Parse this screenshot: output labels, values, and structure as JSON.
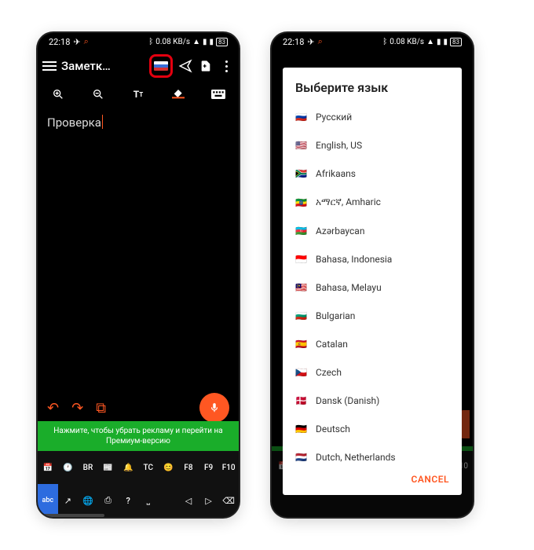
{
  "status": {
    "time": "22:18",
    "right_text": "0.08 KB/s",
    "icons": "✈ ⌕ ⋯"
  },
  "left": {
    "title": "Заметк…",
    "editor_text": "Проверка",
    "promo": "Нажмите, чтобы убрать рекламу и перейти на Премиум-версию",
    "kb_row1": [
      "📅",
      "🕐",
      "BR",
      "📰",
      "🔔",
      "TC",
      "😊",
      "F8",
      "F9",
      "F10"
    ],
    "kb_row2": [
      "abc",
      "↗",
      "🌐",
      "⎙",
      "?",
      "⎵",
      "",
      "◁",
      "▷",
      "⌫"
    ]
  },
  "dialog": {
    "title": "Выберите язык",
    "cancel": "CANCEL",
    "languages": [
      {
        "flag": "🇷🇺",
        "name": "Русский"
      },
      {
        "flag": "🇺🇸",
        "name": "English, US"
      },
      {
        "flag": "🇿🇦",
        "name": "Afrikaans"
      },
      {
        "flag": "🇪🇹",
        "name": "አማርኛ, Amharic"
      },
      {
        "flag": "🇦🇿",
        "name": "Azərbaycan"
      },
      {
        "flag": "🇮🇩",
        "name": "Bahasa, Indonesia"
      },
      {
        "flag": "🇲🇾",
        "name": "Bahasa, Melayu"
      },
      {
        "flag": "🇧🇬",
        "name": "Bulgarian"
      },
      {
        "flag": "🇪🇸",
        "name": "Catalan"
      },
      {
        "flag": "🇨🇿",
        "name": "Czech"
      },
      {
        "flag": "🇩🇰",
        "name": "Dansk (Danish)"
      },
      {
        "flag": "🇩🇪",
        "name": "Deutsch"
      },
      {
        "flag": "🇳🇱",
        "name": "Dutch, Netherlands"
      }
    ]
  }
}
